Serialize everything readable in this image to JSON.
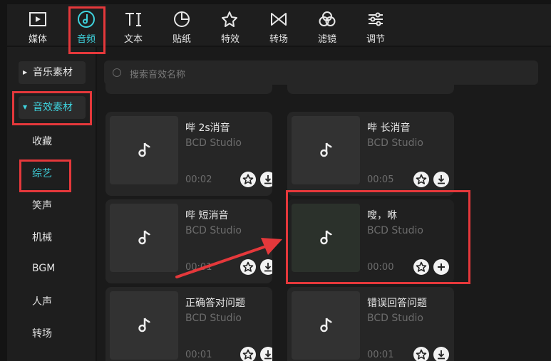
{
  "toolbar": {
    "tabs": [
      {
        "label": "媒体",
        "icon": "media-icon"
      },
      {
        "label": "音频",
        "icon": "audio-icon",
        "active": true
      },
      {
        "label": "文本",
        "icon": "text-icon"
      },
      {
        "label": "贴纸",
        "icon": "sticker-icon"
      },
      {
        "label": "特效",
        "icon": "effects-icon"
      },
      {
        "label": "转场",
        "icon": "transition-icon"
      },
      {
        "label": "滤镜",
        "icon": "filter-icon"
      },
      {
        "label": "调节",
        "icon": "adjust-icon"
      }
    ]
  },
  "sidebar": {
    "music_category": "音乐素材",
    "sfx_category": "音效素材",
    "sub_items": [
      "收藏",
      "综艺",
      "笑声",
      "机械",
      "BGM",
      "人声",
      "转场"
    ],
    "active_sub": "综艺"
  },
  "search": {
    "placeholder": "搜索音效名称"
  },
  "cards": [
    {
      "title": "哔 2s消音",
      "author": "BCD Studio",
      "duration": "00:02"
    },
    {
      "title": "哔 长消音",
      "author": "BCD Studio",
      "duration": "00:05"
    },
    {
      "title": "哔 短消音",
      "author": "BCD Studio",
      "duration": "00:01"
    },
    {
      "title": "嗖，咻",
      "author": "BCD Studio",
      "duration": "00:00"
    },
    {
      "title": "正确答对问题",
      "author": "BCD Studio",
      "duration": "00:01"
    },
    {
      "title": "错误回答问题",
      "author": "BCD Studio",
      "duration": "00:01"
    }
  ],
  "colors": {
    "accent": "#3fd3de",
    "highlight": "#e5383b"
  }
}
